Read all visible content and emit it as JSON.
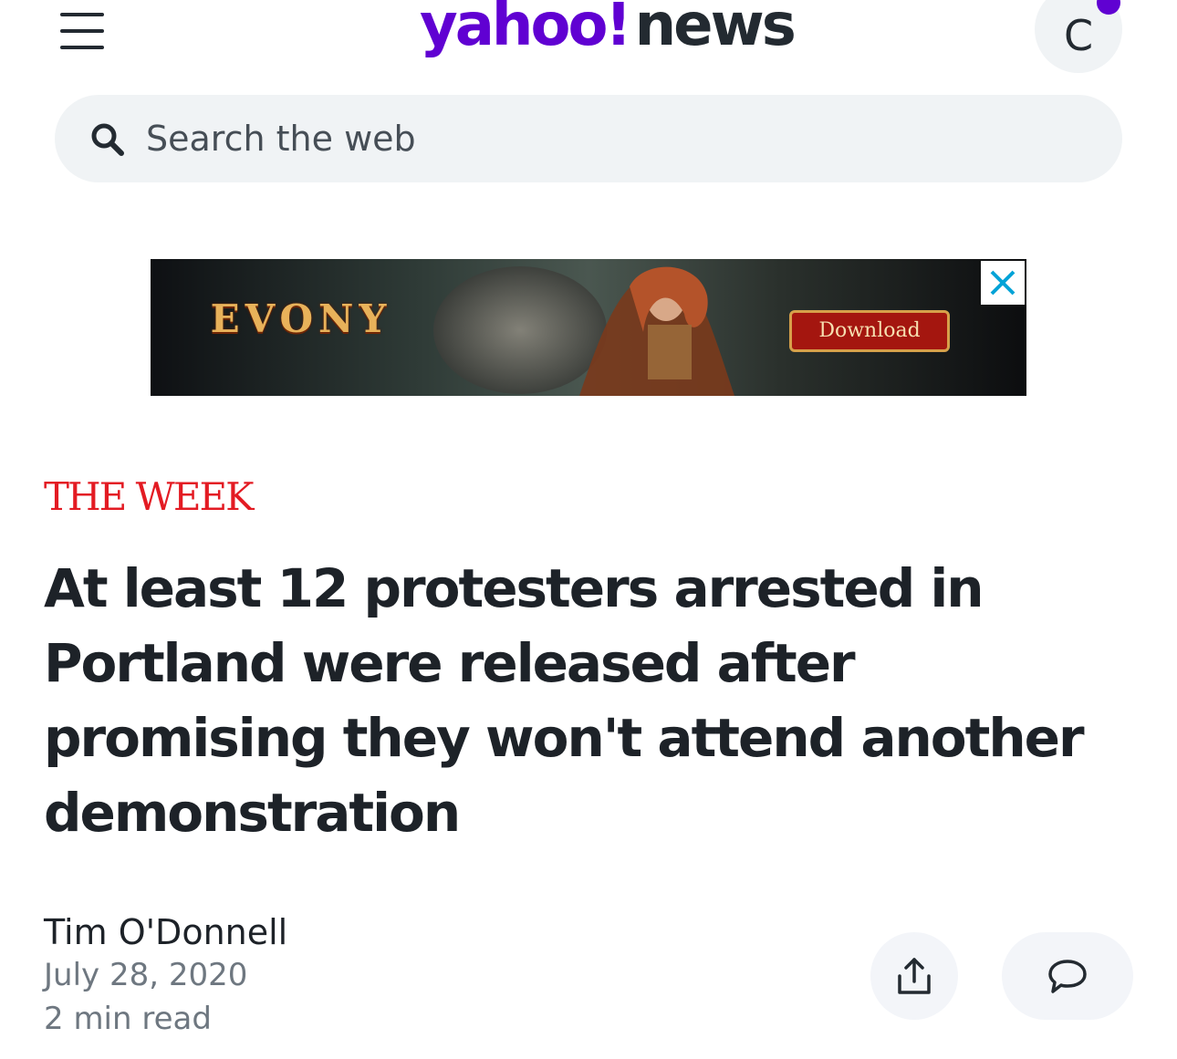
{
  "header": {
    "logo_yahoo": "yahoo!",
    "logo_news": "news",
    "avatar_initial": "C"
  },
  "search": {
    "placeholder": "Search the web",
    "value": ""
  },
  "ad": {
    "brand": "EVONY",
    "cta": "Download",
    "close_icon": "close-icon"
  },
  "article": {
    "publisher": "THE WEEK",
    "headline": "At least 12 protesters arrested in Portland were released after promising they won't attend another demonstration",
    "author": "Tim O'Donnell",
    "date": "July 28, 2020",
    "read_time": "2 min read"
  },
  "actions": {
    "share_icon": "share-icon",
    "comment_icon": "comment-icon"
  },
  "colors": {
    "brand_purple": "#6001d2",
    "publisher_red": "#e31b23",
    "text_dark": "#1d2228",
    "text_muted": "#6e7780",
    "pill_bg": "#f0f3f5"
  }
}
